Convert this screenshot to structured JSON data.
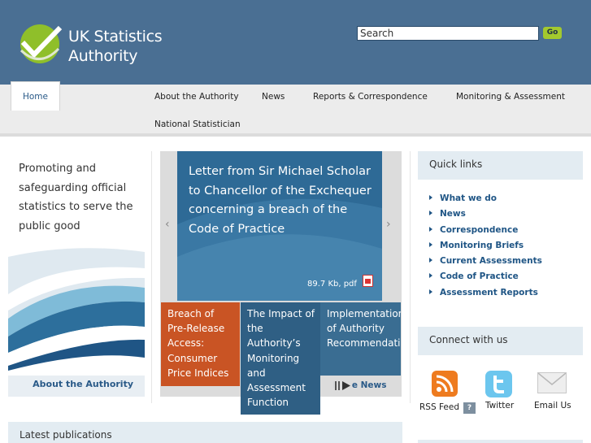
{
  "header": {
    "logo_line1": "UK Statistics",
    "logo_line2": "Authority",
    "search_value": "Search",
    "go_label": "Go",
    "bg_color": "#4a6f93"
  },
  "nav": {
    "home": "Home",
    "items": [
      "About the Authority",
      "News",
      "Reports & Correspondence",
      "Monitoring & Assessment",
      "National Statistician"
    ]
  },
  "intro": {
    "tagline": "Promoting and safeguarding official statistics to serve the public good",
    "about_link": "About the Authority"
  },
  "feature": {
    "title": "Letter from Sir Michael Scholar to Chancellor of the Exchequer concerning a breach of the Code of Practice",
    "file_info": "89.7 Kb, pdf",
    "prev_arrow": "‹",
    "next_arrow": "›",
    "tiles": [
      "Breach of Pre-Release Access: Consumer Price Indices",
      "The Impact of the Authority’s Monitoring and Assessment Function",
      "Implementation of Authority Recommendations"
    ],
    "more_news": "More News"
  },
  "quick_links": {
    "heading": "Quick links",
    "items": [
      "What we do",
      "News",
      "Correspondence",
      "Monitoring Briefs",
      "Current Assessments",
      "Code of Practice",
      "Assessment Reports"
    ]
  },
  "connect": {
    "heading": "Connect with us",
    "rss": "RSS Feed",
    "help": "?",
    "twitter": "Twitter",
    "email": "Email Us"
  },
  "latest": {
    "heading": "Latest publications"
  }
}
